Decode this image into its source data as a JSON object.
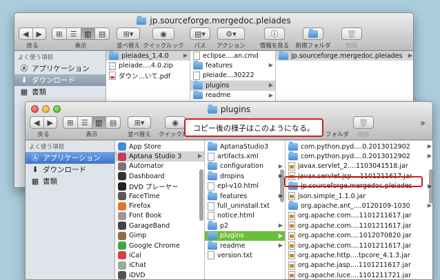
{
  "back_window": {
    "title": "jp.sourceforge.mergedoc.pleiades",
    "toolbar": {
      "back_label": "戻る",
      "view_label": "表示",
      "arrange_label": "並べ替え",
      "quicklook_label": "クイックルック",
      "path_label": "パス",
      "action_label": "アクション",
      "info_label": "情報を見る",
      "newfolder_label": "新規フォルダ",
      "delete_label": "削除"
    },
    "sidebar": {
      "heading": "よく使う項目",
      "items": [
        {
          "label": "アプリケーション",
          "icon": "applications-icon"
        },
        {
          "label": "ダウンロード",
          "icon": "downloads-icon"
        },
        {
          "label": "書類",
          "icon": "documents-icon"
        }
      ]
    },
    "col1": [
      "pleiades_1.4.0",
      "pleiade....4.0.zip",
      "ダウン…いて.pdf"
    ],
    "col2": [
      "eclipse....an.cmd",
      "features",
      "pleiade…30222",
      "plugins",
      "readme"
    ],
    "col3": [
      "jp.sourceforge.mergedoc.pleiades"
    ]
  },
  "front_window": {
    "title": "plugins",
    "toolbar": {
      "back_label": "戻る",
      "view_label": "表示",
      "arrange_label": "並べ替え",
      "quicklook_label": "クイックル",
      "folder_label": "フォルダ",
      "delete_label": "削除",
      "more_label": "»"
    },
    "sidebar": {
      "heading": "よく使う項目",
      "items": [
        {
          "label": "アプリケーション",
          "icon": "applications-icon"
        },
        {
          "label": "ダウンロード",
          "icon": "downloads-icon"
        },
        {
          "label": "書類",
          "icon": "documents-icon"
        }
      ]
    },
    "apps": [
      "App Store",
      "Aptana Studio 3",
      "Automator",
      "Dashboard",
      "DVD プレーヤー",
      "FaceTime",
      "Firefox",
      "Font Book",
      "GarageBand",
      "Gimp",
      "Google Chrome",
      "iCal",
      "iChat",
      "iDVD"
    ],
    "aptana_files": [
      "AptanaStudio3",
      "artifacts.xml",
      "configuration",
      "dropins",
      "epl-v10.html",
      "features",
      "full_uninstall.txt",
      "notice.html",
      "p2",
      "plugins",
      "readme",
      "version.txt"
    ],
    "plugins": [
      "com.python.pyd....0.2013012902",
      "com.python.pyd....0.2013012902",
      "javax.servlet_2....1103041518.jar",
      "javax.servlet.jsp....1101211617.jar",
      "jp.sourceforge.mergedoc.pleiades",
      "json.simple_1.1.0.jar",
      "org.apache.ant_....0120109-1030",
      "org.apache.com....1101211617.jar",
      "org.apache.com....1101211617.jar",
      "org.apache.com....1012070820.jar",
      "org.apache.com....1101211617.jar",
      "org.apache.http....tpcore_4.1.3.jar",
      "org.apache.jasp....1101211617.jar",
      "org.apache.luce....1101211721.jar"
    ]
  },
  "callout": {
    "text": "コピー後の様子はこのようになる。"
  },
  "colors": {
    "accent_red": "#d01c1c",
    "selection_green": "#6cbf3b",
    "selection_blue": "#3b74cc"
  }
}
